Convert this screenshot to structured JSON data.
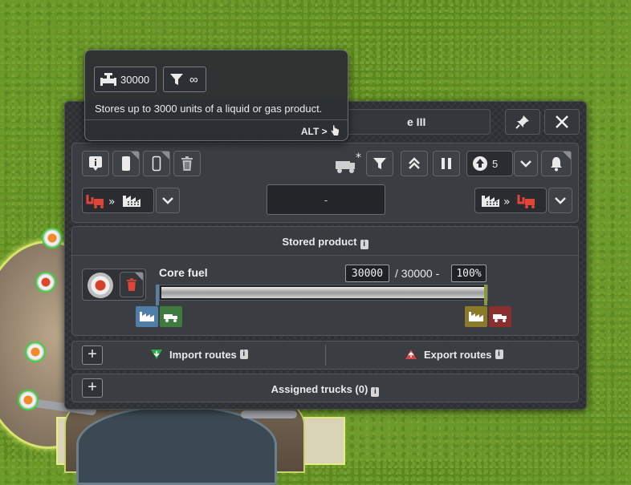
{
  "window": {
    "title_visible": "e III"
  },
  "tooltip": {
    "capacity_value": "30000",
    "throughput_value": "∞",
    "description": "Stores up to 3000 units of a liquid or gas product.",
    "alt_hint": "ALT >"
  },
  "toolbar": {
    "priority_value": "5",
    "center_value": "-"
  },
  "stored_product": {
    "header": "Stored product",
    "product_name": "Core fuel",
    "current_amount": "30000",
    "separator": "/ 30000 -",
    "percent": "100%",
    "fill_fraction": 1.0
  },
  "routes": {
    "import_label": "Import routes",
    "export_label": "Export routes"
  },
  "trucks": {
    "label": "Assigned trucks (0)"
  },
  "colors": {
    "import_green": "#2fa84a",
    "export_red": "#d64545",
    "truck_red": "#e0453a",
    "tag_blue": "#4f7fa8",
    "tag_green": "#3f7a3f",
    "tag_olive": "#8a7a2a",
    "tag_red": "#8a2e2e"
  }
}
